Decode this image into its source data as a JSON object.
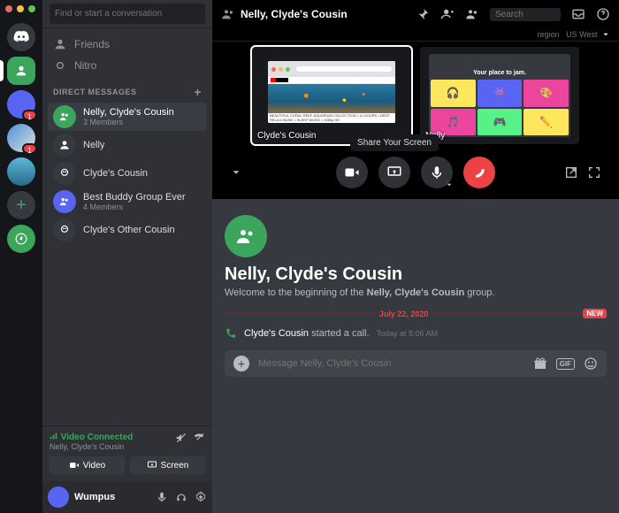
{
  "app": {
    "search_placeholder": "Find or start a conversation"
  },
  "servers": {
    "b1": "1",
    "b2": "1"
  },
  "sidebar": {
    "friends_label": "Friends",
    "nitro_label": "Nitro",
    "dm_header": "DIRECT MESSAGES",
    "items": [
      {
        "name": "Nelly, Clyde's Cousin",
        "sub": "3 Members"
      },
      {
        "name": "Nelly",
        "sub": ""
      },
      {
        "name": "Clyde's Cousin",
        "sub": ""
      },
      {
        "name": "Best Buddy Group Ever",
        "sub": "4 Members"
      },
      {
        "name": "Clyde's Other Cousin",
        "sub": ""
      }
    ]
  },
  "voice": {
    "status": "Video Connected",
    "channel": "Nelly, Clyde's Cousin",
    "video_label": "Video",
    "screen_label": "Screen"
  },
  "user": {
    "name": "Wumpus"
  },
  "header": {
    "title": "Nelly, Clyde's Cousin",
    "search_placeholder": "Search",
    "region_label": "region",
    "region_value": "US West"
  },
  "call": {
    "tile0_name": "Clyde's Cousin",
    "tile0_caption": "BEAUTIFUL CORAL REEF AQUARIUM COLLECTION • 12 HOURS • DEEP RELAX MUSIC • SLEEP MUSIC • 1080p HD",
    "tile1_name": "Nelly",
    "tile1_heading": "Your place to jam.",
    "tooltip": "Share Your Screen"
  },
  "content": {
    "title": "Nelly, Clyde's Cousin",
    "welcome_pre": "Welcome to the beginning of the ",
    "welcome_bold": "Nelly, Clyde's Cousin",
    "welcome_post": " group.",
    "date": "July 22, 2020",
    "new_badge": "NEW",
    "msg_name": "Clyde's Cousin",
    "msg_body": " started a call.",
    "msg_time": "Today at 8:06 AM",
    "composer_placeholder": "Message Nelly, Clyde's Cousin",
    "gif_label": "GIF"
  }
}
